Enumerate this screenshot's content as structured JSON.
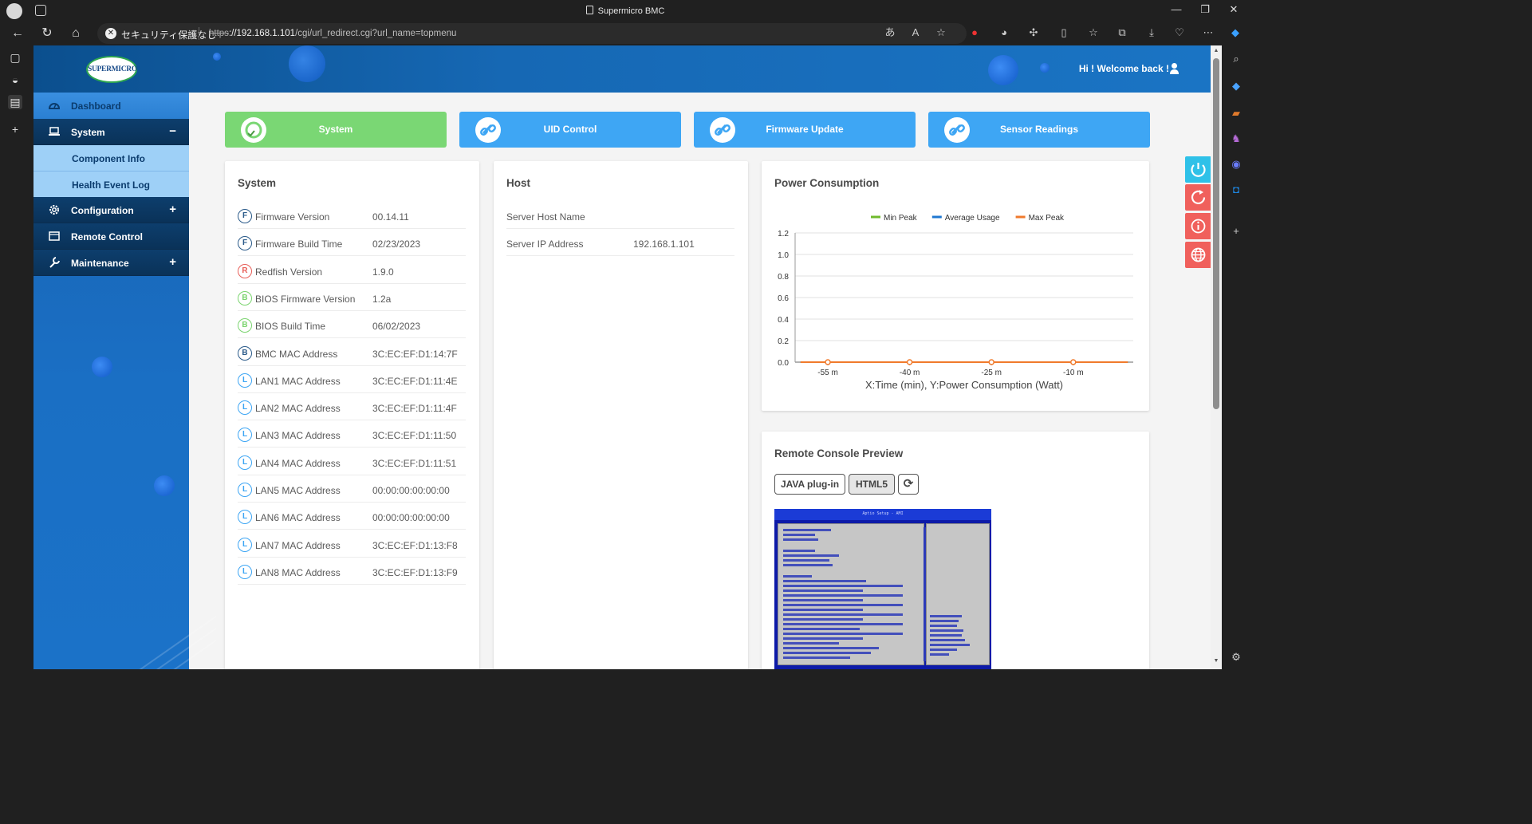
{
  "browser": {
    "window_title": "Supermicro BMC",
    "security_label": "セキュリティ保護なし",
    "url_proto": "https",
    "url_host": "://192.168.1.101",
    "url_path": "/cgi/url_redirect.cgi?url_name=topmenu"
  },
  "header": {
    "logo_text": "SUPERMICRO",
    "welcome": "Hi ! Welcome back !"
  },
  "sidebar": {
    "items": [
      {
        "label": "Dashboard",
        "icon": "dashboard-gauge-icon"
      },
      {
        "label": "System",
        "icon": "laptop-icon",
        "toggle": "−"
      },
      {
        "label": "Component Info"
      },
      {
        "label": "Health Event Log"
      },
      {
        "label": "Configuration",
        "icon": "gear-icon",
        "toggle": "+"
      },
      {
        "label": "Remote Control",
        "icon": "console-window-icon"
      },
      {
        "label": "Maintenance",
        "icon": "wrench-icon",
        "toggle": "+"
      }
    ]
  },
  "top_cards": [
    {
      "label": "System",
      "color": "#7ad774"
    },
    {
      "label": "UID Control",
      "color": "#3ea6f4"
    },
    {
      "label": "Firmware Update",
      "color": "#3ea6f4"
    },
    {
      "label": "Sensor Readings",
      "color": "#3ea6f4"
    }
  ],
  "system_panel": {
    "title": "System",
    "rows": [
      {
        "badge": "F",
        "badge_color": "#2b5b8a",
        "label": "Firmware Version",
        "value": "00.14.11"
      },
      {
        "badge": "F",
        "badge_color": "#2b5b8a",
        "label": "Firmware Build Time",
        "value": "02/23/2023"
      },
      {
        "badge": "R",
        "badge_color": "#e8605a",
        "label": "Redfish Version",
        "value": "1.9.0"
      },
      {
        "badge": "B",
        "badge_color": "#7bd46f",
        "label": "BIOS Firmware Version",
        "value": "1.2a"
      },
      {
        "badge": "B",
        "badge_color": "#7bd46f",
        "label": "BIOS Build Time",
        "value": "06/02/2023"
      },
      {
        "badge": "B",
        "badge_color": "#2b5b8a",
        "label": "BMC MAC Address",
        "value": "3C:EC:EF:D1:14:7F"
      },
      {
        "badge": "L",
        "badge_color": "#3ea6f4",
        "label": "LAN1 MAC Address",
        "value": "3C:EC:EF:D1:11:4E"
      },
      {
        "badge": "L",
        "badge_color": "#3ea6f4",
        "label": "LAN2 MAC Address",
        "value": "3C:EC:EF:D1:11:4F"
      },
      {
        "badge": "L",
        "badge_color": "#3ea6f4",
        "label": "LAN3 MAC Address",
        "value": "3C:EC:EF:D1:11:50"
      },
      {
        "badge": "L",
        "badge_color": "#3ea6f4",
        "label": "LAN4 MAC Address",
        "value": "3C:EC:EF:D1:11:51"
      },
      {
        "badge": "L",
        "badge_color": "#3ea6f4",
        "label": "LAN5 MAC Address",
        "value": "00:00:00:00:00:00"
      },
      {
        "badge": "L",
        "badge_color": "#3ea6f4",
        "label": "LAN6 MAC Address",
        "value": "00:00:00:00:00:00"
      },
      {
        "badge": "L",
        "badge_color": "#3ea6f4",
        "label": "LAN7 MAC Address",
        "value": "3C:EC:EF:D1:13:F8"
      },
      {
        "badge": "L",
        "badge_color": "#3ea6f4",
        "label": "LAN8 MAC Address",
        "value": "3C:EC:EF:D1:13:F9"
      }
    ]
  },
  "host_panel": {
    "title": "Host",
    "rows": [
      {
        "label": "Server Host Name",
        "value": ""
      },
      {
        "label": "Server IP Address",
        "value": "192.168.1.101"
      }
    ]
  },
  "power_panel": {
    "title": "Power Consumption"
  },
  "chart_data": {
    "type": "line",
    "xlabel": "X:Time (min), Y:Power Consumption (Watt)",
    "ylabel": "",
    "x": [
      -60,
      -50,
      -40,
      -30,
      -20,
      -10,
      0
    ],
    "x_ticks": [
      "-55 m",
      "-40 m",
      "-25 m",
      "-10 m"
    ],
    "x_tick_values": [
      -55,
      -40,
      -25,
      -10
    ],
    "ylim": [
      0,
      1.2
    ],
    "y_ticks": [
      "1.2",
      "1.0",
      "0.8",
      "0.6",
      "0.4",
      "0.2",
      "0.0"
    ],
    "y_tick_values": [
      1.2,
      1.0,
      0.8,
      0.6,
      0.4,
      0.2,
      0.0
    ],
    "xlim": [
      -61,
      1
    ],
    "grid": true,
    "legend": "top-center",
    "series": [
      {
        "name": "Min Peak",
        "color": "#6fba2c",
        "values": [
          0,
          0,
          0,
          0,
          0,
          0,
          0
        ]
      },
      {
        "name": "Average Usage",
        "color": "#1f78d1",
        "values": [
          0,
          0,
          0,
          0,
          0,
          0,
          0
        ]
      },
      {
        "name": "Max Peak",
        "color": "#f07a2c",
        "values": [
          0,
          0,
          0,
          0,
          0,
          0,
          0
        ]
      }
    ],
    "marker_x": [
      -55,
      -40,
      -25,
      -10
    ]
  },
  "console_panel": {
    "title": "Remote Console Preview",
    "java_label": "JAVA plug-in",
    "html5_label": "HTML5",
    "screen_header": "Aptio Setup - AMI"
  },
  "colors": {
    "power_button": "#2fc1e8",
    "reset_button": "#f0605c",
    "info_button": "#f0605c",
    "globe_button": "#f0605c"
  }
}
